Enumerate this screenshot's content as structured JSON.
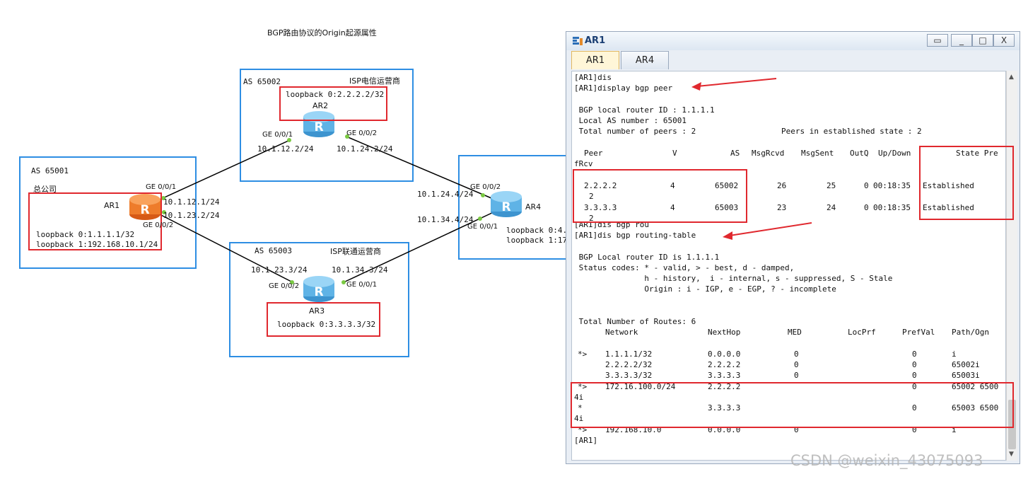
{
  "diagram": {
    "title": "BGP路由协议的Origin起源属性",
    "as65001": {
      "label": "AS 65001",
      "org": "总公司"
    },
    "as65002": {
      "label": "AS 65002",
      "org": "ISP电信运营商"
    },
    "as65003": {
      "label": "AS 65003",
      "org": "ISP联通运营商"
    },
    "ar1": {
      "name": "AR1",
      "lo0": "loopback 0:1.1.1.1/32",
      "lo1": "loopback 1:192.168.10.1/24",
      "ge1": "GE 0/0/1",
      "ge2": "GE 0/0/2",
      "ip1": "10.1.12.1/24",
      "ip2": "10.1.23.2/24"
    },
    "ar2": {
      "name": "AR2",
      "lo0": "loopback 0:2.2.2.2/32",
      "ge1": "GE 0/0/1",
      "ge2": "GE 0/0/2",
      "ip1": "10.1.12.2/24",
      "ip2": "10.1.24.2/24"
    },
    "ar3": {
      "name": "AR3",
      "lo0": "loopback 0:3.3.3.3/32",
      "ge2": "GE 0/0/2",
      "ge1": "GE 0/0/1",
      "ip1": "10.1.23.3/24",
      "ip2": "10.1.34.3/24"
    },
    "ar4": {
      "name": "AR4",
      "lo0": "loopback 0:4.",
      "lo1": "loopback 1:17",
      "ge2": "GE 0/0/2",
      "ge1": "GE 0/0/1",
      "ip1": "10.1.24.4/24",
      "ip2": "10.1.34.4/24"
    }
  },
  "window": {
    "title": "AR1",
    "tabs": [
      "AR1",
      "AR4"
    ],
    "buttons": {
      "restore_small": "▭",
      "minimize": "_",
      "maximize": "□",
      "close": "X"
    },
    "terminal": {
      "cmd1a": "[AR1]dis",
      "cmd1b": "[AR1]display bgp peer",
      "peer_header": {
        "router_id": " BGP local router ID : 1.1.1.1",
        "local_as": " Local AS number : 65001",
        "total_peers": " Total number of peers : 2",
        "established": "Peers in established state : 2"
      },
      "peer_cols": [
        "Peer",
        "V",
        "AS",
        "MsgRcvd",
        "MsgSent",
        "OutQ",
        "Up/Down",
        "State Pre"
      ],
      "peer_cols_wrap": "fRcv",
      "peers": [
        {
          "peer": "2.2.2.2",
          "v": "4",
          "as": "65002",
          "rcvd": "26",
          "sent": "25",
          "outq": "0",
          "updown": "00:18:35",
          "state": "Established",
          "pref": "2"
        },
        {
          "peer": "3.3.3.3",
          "v": "4",
          "as": "65003",
          "rcvd": "23",
          "sent": "24",
          "outq": "0",
          "updown": "00:18:35",
          "state": "Established",
          "pref": "2"
        }
      ],
      "cmd2a": "[AR1]dis bgp rou",
      "cmd2b": "[AR1]dis bgp routing-table",
      "rt_header": {
        "router_id": " BGP Local router ID is 1.1.1.1",
        "status1": " Status codes: * - valid, > - best, d - damped,",
        "status2": "               h - history,  i - internal, s - suppressed, S - Stale",
        "status3": "               Origin : i - IGP, e - EGP, ? - incomplete",
        "total": " Total Number of Routes: 6"
      },
      "rt_cols": [
        "Network",
        "NextHop",
        "MED",
        "LocPrf",
        "PrefVal",
        "Path/Ogn"
      ],
      "routes": [
        {
          "flag": "*>",
          "network": "1.1.1.1/32",
          "nexthop": "0.0.0.0",
          "med": "0",
          "locprf": "",
          "prefval": "0",
          "path": "i",
          "wrap": ""
        },
        {
          "flag": "",
          "network": "2.2.2.2/32",
          "nexthop": "2.2.2.2",
          "med": "0",
          "locprf": "",
          "prefval": "0",
          "path": "65002i",
          "wrap": ""
        },
        {
          "flag": "",
          "network": "3.3.3.3/32",
          "nexthop": "3.3.3.3",
          "med": "0",
          "locprf": "",
          "prefval": "0",
          "path": "65003i",
          "wrap": ""
        },
        {
          "flag": "*>",
          "network": "172.16.100.0/24",
          "nexthop": "2.2.2.2",
          "med": "",
          "locprf": "",
          "prefval": "0",
          "path": "65002 6500",
          "wrap": "4i"
        },
        {
          "flag": "*",
          "network": "",
          "nexthop": "3.3.3.3",
          "med": "",
          "locprf": "",
          "prefval": "0",
          "path": "65003 6500",
          "wrap": "4i"
        },
        {
          "flag": "*>",
          "network": "192.168.10.0",
          "nexthop": "0.0.0.0",
          "med": "0",
          "locprf": "",
          "prefval": "0",
          "path": "i",
          "wrap": ""
        }
      ],
      "prompt": "[AR1]"
    }
  },
  "watermark": "CSDN @weixin_43075093",
  "colors": {
    "as_border": "#2e8ee3",
    "highlight": "#e0282e",
    "link_dot": "#7ac943"
  }
}
